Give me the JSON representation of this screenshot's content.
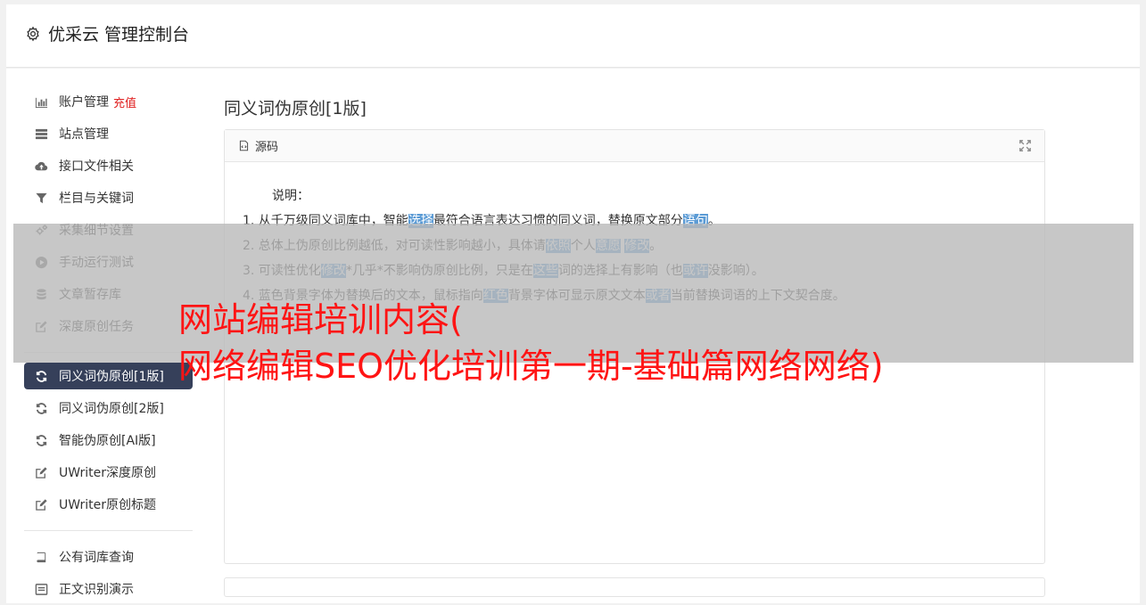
{
  "app": {
    "title": "优采云 管理控制台"
  },
  "sidebar": {
    "group1": [
      {
        "icon": "bar-chart-icon",
        "label": "账户管理",
        "badge": "充值"
      },
      {
        "icon": "server-icon",
        "label": "站点管理"
      },
      {
        "icon": "cloud-upload-icon",
        "label": "接口文件相关"
      },
      {
        "icon": "filter-icon",
        "label": "栏目与关键词"
      },
      {
        "icon": "cogs-icon",
        "label": "采集细节设置"
      },
      {
        "icon": "play-circle-icon",
        "label": "手动运行测试"
      },
      {
        "icon": "database-icon",
        "label": "文章暂存库"
      },
      {
        "icon": "edit-icon",
        "label": "深度原创任务"
      }
    ],
    "group2": [
      {
        "icon": "refresh-icon",
        "label": "同义词伪原创[1版]",
        "active": true
      },
      {
        "icon": "refresh-icon",
        "label": "同义词伪原创[2版]"
      },
      {
        "icon": "refresh-icon",
        "label": "智能伪原创[AI版]"
      },
      {
        "icon": "edit-icon",
        "label": "UWriter深度原创"
      },
      {
        "icon": "edit-icon",
        "label": "UWriter原创标题"
      }
    ],
    "group3": [
      {
        "icon": "book-icon",
        "label": "公有词库查询"
      },
      {
        "icon": "list-icon",
        "label": "正文识别演示"
      }
    ]
  },
  "content": {
    "title": "同义词伪原创[1版]",
    "panel_title": "源码",
    "note_title": "说明：",
    "notes": [
      [
        {
          "t": "1. 从千万级同义词库中，智能"
        },
        {
          "t": "选择",
          "hl": true
        },
        {
          "t": "最符合语言表达习惯的同义词，替换原文部分"
        },
        {
          "t": "语句",
          "hl": true
        },
        {
          "t": "。"
        }
      ],
      [
        {
          "t": "2. 总体上伪原创比例越低，对可读性影响越小，具体请"
        },
        {
          "t": "依照",
          "hl": true
        },
        {
          "t": "个人"
        },
        {
          "t": "意愿",
          "hl": true
        },
        {
          "t": " "
        },
        {
          "t": "修改",
          "hl": true
        },
        {
          "t": "。"
        }
      ],
      [
        {
          "t": "3. 可读性优化"
        },
        {
          "t": "修改",
          "hl": true
        },
        {
          "t": "*几乎*不影响伪原创比例，只是在"
        },
        {
          "t": "这些",
          "hl": true
        },
        {
          "t": "词的选择上有影响（也"
        },
        {
          "t": "或许",
          "hl": true
        },
        {
          "t": "没影响）。"
        }
      ],
      [
        {
          "t": "4. 蓝色背景字体为替换后的文本，鼠标指向"
        },
        {
          "t": "红色",
          "hl": true
        },
        {
          "t": "背景字体可显示原文文本"
        },
        {
          "t": "或者",
          "hl": true
        },
        {
          "t": "当前替换词语的上下文契合度。"
        }
      ]
    ]
  },
  "overlay": {
    "line1": "网站编辑培训内容(",
    "line2": "网络编辑SEO优化培训第一期-基础篇网络网络)"
  },
  "colors": {
    "active_bg": "#36405a",
    "highlight": "#5b9bd5",
    "headline": "#ff1414",
    "badge": "#e02020"
  }
}
